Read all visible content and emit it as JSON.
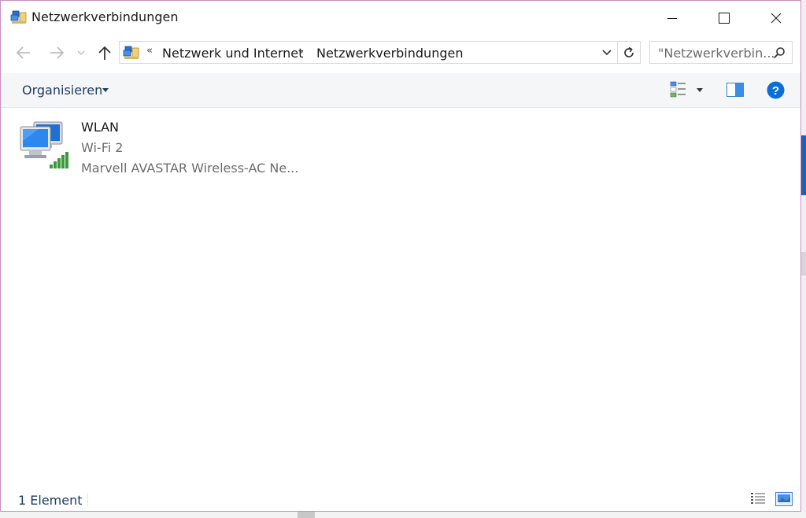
{
  "window": {
    "title": "Netzwerkverbindungen",
    "controls": [
      "minimize",
      "maximize",
      "close"
    ]
  },
  "navigation": {
    "address_overflow": "«",
    "breadcrumbs": [
      "Netzwerk und Internet",
      "Netzwerkverbindungen"
    ],
    "separator": "›",
    "search_placeholder": "\"Netzwerkverbin...",
    "icons": [
      "back-arrow-icon",
      "forward-arrow-icon",
      "recent-locations-icon",
      "up-arrow-icon",
      "refresh-icon",
      "search-icon"
    ]
  },
  "commandbar": {
    "organize_label": "Organisieren",
    "icons": [
      "change-view-icon",
      "preview-pane-icon",
      "help-icon"
    ]
  },
  "connection": {
    "name": "WLAN",
    "network": "Wi-Fi 2",
    "adapter": "Marvell AVASTAR Wireless-AC Ne...",
    "icon": "wireless-network-icon"
  },
  "statusbar": {
    "count": "1 Element",
    "icons": [
      "details-view-icon",
      "large-icons-view-icon"
    ]
  },
  "colors": {
    "accent": "#0078d7",
    "window_border": "#c98fc3",
    "link_text": "#1e3a5f",
    "muted_text": "#6d6d6d",
    "signal_green": "#3c9a3c"
  }
}
